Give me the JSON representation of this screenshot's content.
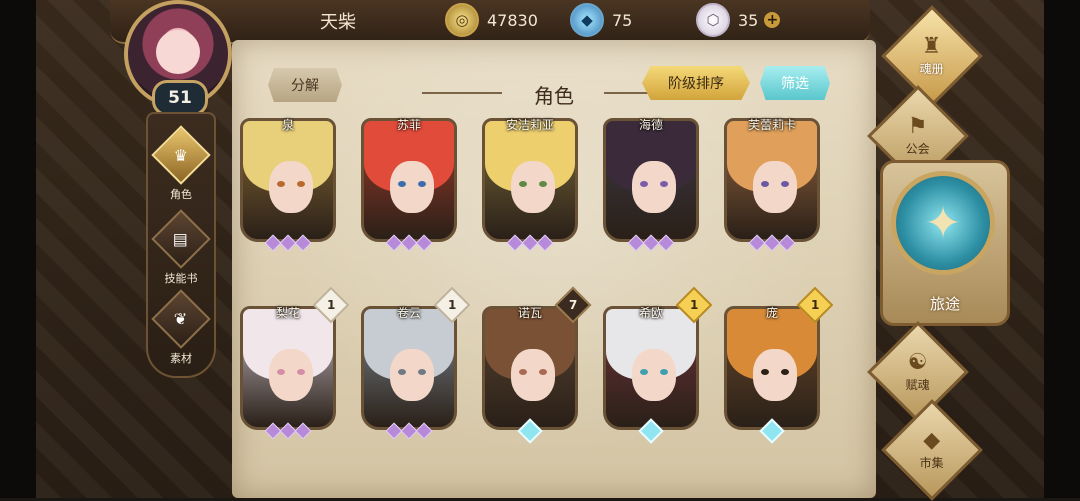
{
  "player": {
    "name": "天柴",
    "level": "51"
  },
  "resources": {
    "gold": "47830",
    "gems": "75",
    "crystals": "35",
    "plus_symbol": "+"
  },
  "left_nav": [
    {
      "label": "角色",
      "icon": "helmet-icon",
      "glyph": "♛",
      "active": true
    },
    {
      "label": "技能书",
      "icon": "book-icon",
      "glyph": "▤",
      "active": false
    },
    {
      "label": "素材",
      "icon": "wing-crest-icon",
      "glyph": "❦",
      "active": false
    }
  ],
  "panel": {
    "title": "角色",
    "decompose_button": "分解",
    "sort_button": "阶级排序",
    "filter_button": "筛选"
  },
  "characters": [
    {
      "name": "泉",
      "hair": "#e8cf7a",
      "eye": "#b86a2a",
      "bg": "#8b6a35",
      "badge": "",
      "badge_style": "none",
      "gems": "purple"
    },
    {
      "name": "苏菲",
      "hair": "#e14b3a",
      "eye": "#3e6bb0",
      "bg": "#a33b2a",
      "badge": "",
      "badge_style": "none",
      "gems": "purple"
    },
    {
      "name": "安洁莉亚",
      "hair": "#edcf6e",
      "eye": "#5c8b47",
      "bg": "#7a6a3a",
      "badge": "",
      "badge_style": "none",
      "gems": "purple"
    },
    {
      "name": "海德",
      "hair": "#3b2b3a",
      "eye": "#7a5ca8",
      "bg": "#3e3a45",
      "badge": "",
      "badge_style": "none",
      "gems": "purple"
    },
    {
      "name": "芙蕾莉卡",
      "hair": "#e0a05b",
      "eye": "#6b5aa3",
      "bg": "#9a6740",
      "badge": "",
      "badge_style": "none",
      "gems": "purple"
    },
    {
      "name": "梨花",
      "hair": "#f1e6ea",
      "eye": "#d58ca7",
      "bg": "#c9c0c8",
      "badge": "1",
      "badge_style": "white",
      "gems": "purple"
    },
    {
      "name": "卷云",
      "hair": "#c7ccd2",
      "eye": "#6f7a86",
      "bg": "#7d8a93",
      "badge": "1",
      "badge_style": "white",
      "gems": "purple"
    },
    {
      "name": "诺瓦",
      "hair": "#7a5134",
      "eye": "#a86a52",
      "bg": "#5a4432",
      "badge": "7",
      "badge_style": "dark",
      "gems": "cyan"
    },
    {
      "name": "希欧",
      "hair": "#e7e7ea",
      "eye": "#3f9fb0",
      "bg": "#70343a",
      "badge": "1",
      "badge_style": "gold",
      "gems": "cyan"
    },
    {
      "name": "庞",
      "hair": "#d98a36",
      "eye": "#2b2015",
      "bg": "#6b4a2a",
      "badge": "1",
      "badge_style": "gold",
      "gems": "cyan"
    }
  ],
  "right_nav": [
    {
      "label": "魂册",
      "icon": "soul-book-icon",
      "glyph": "♜",
      "active": true
    },
    {
      "label": "公会",
      "icon": "guild-banner-icon",
      "glyph": "⚑",
      "active": false
    },
    {
      "label": "赋魂",
      "icon": "spiral-icon",
      "glyph": "☯",
      "active": false
    },
    {
      "label": "市集",
      "icon": "market-gem-icon",
      "glyph": "◆",
      "active": false
    }
  ],
  "journey": {
    "label": "旅途",
    "icon": "compass-icon",
    "glyph": "✦"
  }
}
